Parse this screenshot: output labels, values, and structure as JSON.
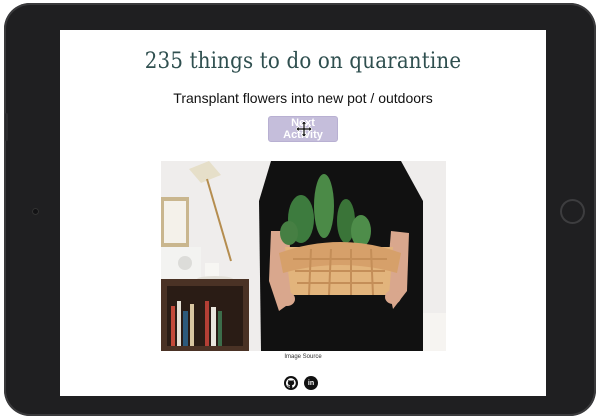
{
  "page": {
    "title": "235 things to do on quarantine",
    "activity": "Transplant flowers into new pot / outdoors",
    "next_button_label": "Next Activity",
    "image_caption": "Image Source",
    "image_alt": "Person holding a woven basket with a cactus plant"
  },
  "socials": {
    "github_icon": "github-icon",
    "linkedin_icon": "linkedin-icon",
    "linkedin_glyph": "in"
  },
  "colors": {
    "title": "#2f4f4f",
    "button_bg": "#c5bedb",
    "device_frame": "#1f1f21"
  }
}
